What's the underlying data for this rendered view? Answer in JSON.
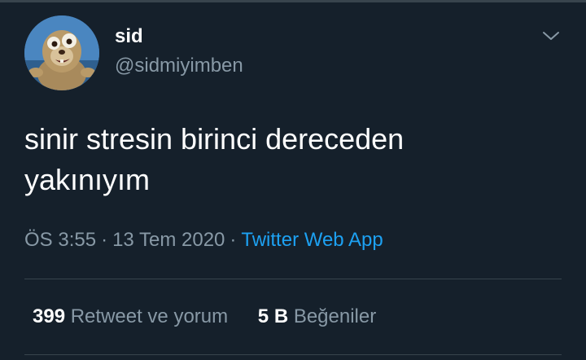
{
  "theme": {
    "background": "#15202b",
    "text": "#ffffff",
    "secondary": "#8899a6",
    "accent": "#1da1f2",
    "divider": "#38444d"
  },
  "tweet": {
    "author": {
      "display_name": "sid",
      "handle": "@sidmiyimben",
      "avatar_icon": "sloth-avatar"
    },
    "menu_icon": "chevron-down-icon",
    "text_lines": [
      "sinir stresin birinci dereceden",
      "yakınıyım"
    ],
    "time": "ÖS 3:55",
    "date": "13 Tem 2020",
    "separator": "·",
    "source": "Twitter Web App"
  },
  "stats": {
    "retweets": {
      "count": "399",
      "label": "Retweet ve yorum"
    },
    "likes": {
      "count": "5 B",
      "label": "Beğeniler"
    }
  }
}
